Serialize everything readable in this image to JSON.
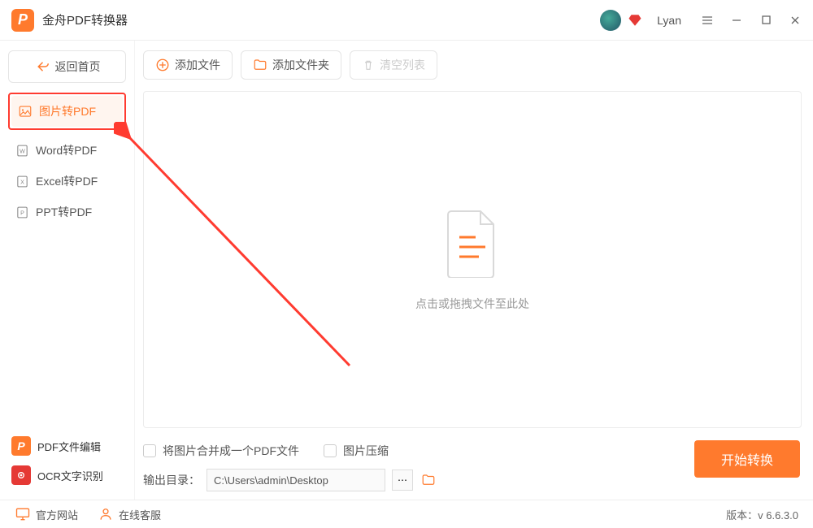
{
  "app": {
    "title": "金舟PDF转换器",
    "user": "Lyan"
  },
  "sidebar": {
    "home_label": "返回首页",
    "items": [
      {
        "label": "图片转PDF"
      },
      {
        "label": "Word转PDF"
      },
      {
        "label": "Excel转PDF"
      },
      {
        "label": "PPT转PDF"
      }
    ],
    "bottom_tools": [
      {
        "label": "PDF文件编辑"
      },
      {
        "label": "OCR文字识别"
      }
    ]
  },
  "toolbar": {
    "add_file": "添加文件",
    "add_folder": "添加文件夹",
    "clear_list": "清空列表"
  },
  "dropzone": {
    "hint": "点击或拖拽文件至此处"
  },
  "options": {
    "merge_label": "将图片合并成一个PDF文件",
    "compress_label": "图片压缩"
  },
  "output": {
    "label": "输出目录：",
    "value": "C:\\Users\\admin\\Desktop"
  },
  "start_btn": "开始转换",
  "footer": {
    "official_site": "官方网站",
    "support": "在线客服",
    "version_label": "版本：",
    "version": "v 6.6.3.0"
  }
}
